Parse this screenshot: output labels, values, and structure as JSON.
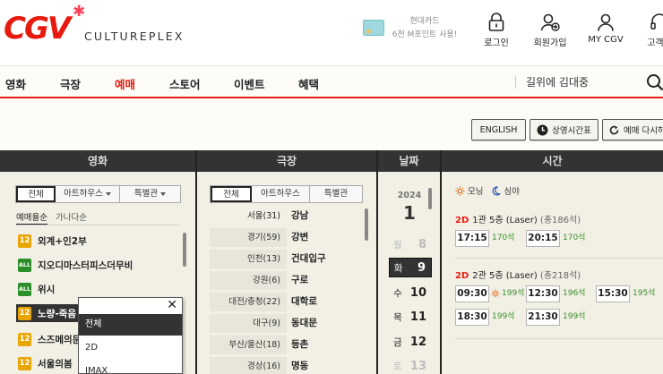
{
  "header": {
    "logo": "CGV",
    "logo_sub": "CULTUREPLEX",
    "promo_line1": "현대카드",
    "promo_line2": "6천 M포인트 사용!",
    "utils": [
      {
        "label": "로그인",
        "icon": "lock-icon"
      },
      {
        "label": "회원가입",
        "icon": "add-user-icon"
      },
      {
        "label": "MY CGV",
        "icon": "person-icon"
      },
      {
        "label": "고객센",
        "icon": "headset-icon"
      }
    ]
  },
  "nav": {
    "items": [
      "영화",
      "극장",
      "예매",
      "스토어",
      "이벤트",
      "혜택"
    ],
    "active": "예매",
    "search_text": "길위에 김대중"
  },
  "buttons": {
    "english": "ENGLISH",
    "schedule": "상영시간표",
    "reset": "예매 다시하"
  },
  "columns": {
    "movie": "영화",
    "theater": "극장",
    "date": "날짜",
    "time": "시간"
  },
  "movie_panel": {
    "tabs": [
      "전체",
      "아트하우스",
      "특별관"
    ],
    "sort_options": [
      "예매율순",
      "가나다순"
    ],
    "movies": [
      {
        "rating": "12",
        "title": "외계+인2부"
      },
      {
        "rating": "ALL",
        "title": "지오디마스터피스더무비"
      },
      {
        "rating": "ALL",
        "title": "위시"
      },
      {
        "rating": "12",
        "title": "노량-죽음"
      },
      {
        "rating": "12",
        "title": "스즈메의문"
      },
      {
        "rating": "12",
        "title": "서울의봄"
      }
    ],
    "dropdown_options": [
      "전체",
      "2D",
      "IMAX"
    ]
  },
  "theater_panel": {
    "tabs": [
      "전체",
      "아트하우스",
      "특별관"
    ],
    "regions": [
      "서울(31)",
      "경기(59)",
      "인천(13)",
      "강원(6)",
      "대전/충청(22)",
      "대구(9)",
      "부산/울산(18)",
      "경상(16)"
    ],
    "theaters": [
      "강남",
      "강변",
      "건대입구",
      "구로",
      "대학로",
      "동대문",
      "등촌",
      "명동"
    ]
  },
  "date_panel": {
    "year": "2024",
    "month": "1",
    "days": [
      {
        "weekday": "월",
        "day": "8",
        "state": "dim"
      },
      {
        "weekday": "화",
        "day": "9",
        "state": "selected"
      },
      {
        "weekday": "수",
        "day": "10",
        "state": "normal"
      },
      {
        "weekday": "목",
        "day": "11",
        "state": "normal"
      },
      {
        "weekday": "금",
        "day": "12",
        "state": "normal"
      },
      {
        "weekday": "토",
        "day": "13",
        "state": "dim"
      }
    ]
  },
  "time_panel": {
    "legend_morning": "모닝",
    "legend_night": "심야",
    "screens": [
      {
        "format": "2D",
        "name": "1관 5층 (Laser)",
        "total": "(총186석)",
        "showtimes": [
          {
            "time": "17:15",
            "seats": "170석"
          },
          {
            "time": "20:15",
            "seats": "170석"
          }
        ]
      },
      {
        "format": "2D",
        "name": "2관 5층 (Laser)",
        "total": "(총218석)",
        "showtimes": [
          {
            "time": "09:30",
            "seats": "199석",
            "morning": true
          },
          {
            "time": "12:30",
            "seats": "196석"
          },
          {
            "time": "15:30",
            "seats": "195석"
          },
          {
            "time": "18:30",
            "seats": "199석"
          },
          {
            "time": "21:30",
            "seats": "199석"
          }
        ]
      }
    ]
  },
  "colors": {
    "brand_red": "#e71a0f",
    "header_dark": "#333333",
    "rating_12": "#e8a400",
    "rating_all": "#2a8f28",
    "seat_green": "#3a8f2a"
  }
}
